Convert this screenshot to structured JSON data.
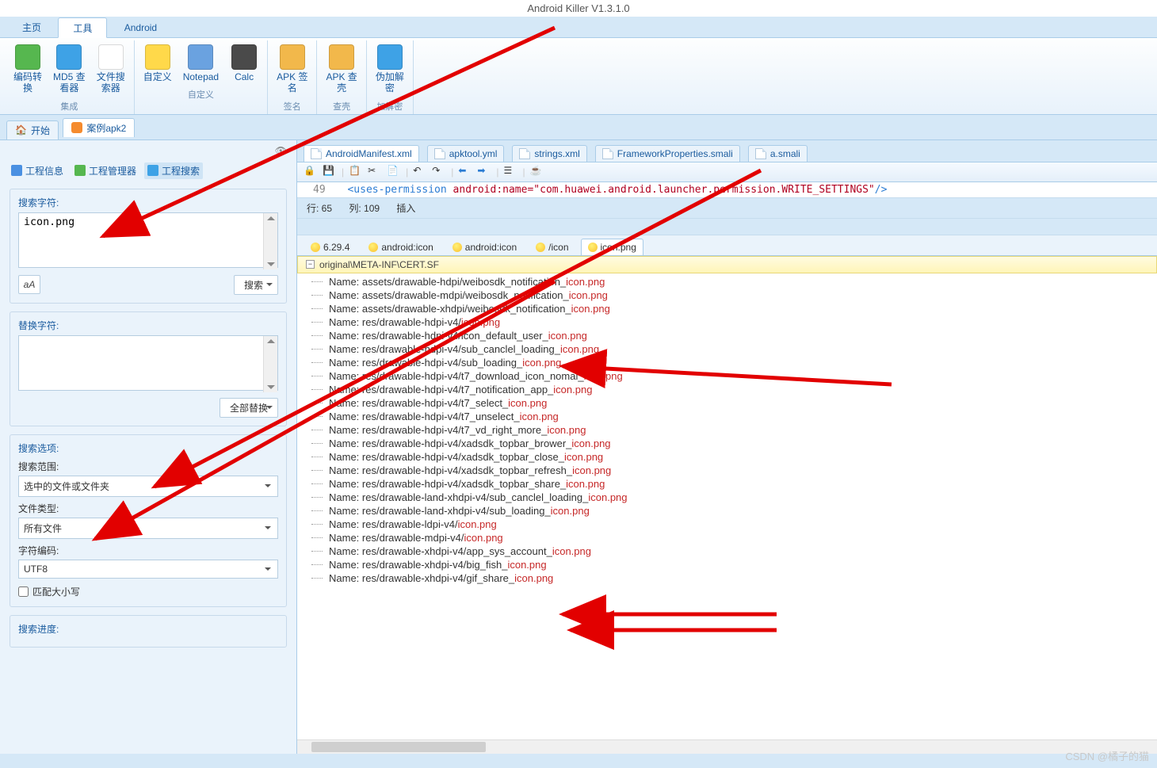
{
  "title": "Android Killer V1.3.1.0",
  "menu": {
    "home": "主页",
    "tools": "工具",
    "android": "Android"
  },
  "ribbon": {
    "group1": {
      "label": "集成",
      "items": [
        {
          "label": "编码转\n换",
          "color": "#56b74f"
        },
        {
          "label": "MD5 查\n看器",
          "color": "#3ea2e6"
        },
        {
          "label": "文件搜\n索器",
          "color": "#ffffff"
        }
      ]
    },
    "group2": {
      "label": "自定义",
      "items": [
        {
          "label": "自定义",
          "color": "#ffd94a"
        },
        {
          "label": "Notepad",
          "color": "#6aa2e0"
        },
        {
          "label": "Calc",
          "color": "#4a4a4a"
        }
      ]
    },
    "group3": {
      "label": "签名",
      "items": [
        {
          "label": "APK 签\n名",
          "color": "#f2b84b"
        }
      ]
    },
    "group4": {
      "label": "查壳",
      "items": [
        {
          "label": "APK 查\n壳",
          "color": "#f2b84b"
        }
      ]
    },
    "group5": {
      "label": "加解密",
      "items": [
        {
          "label": "伪加解\n密",
          "color": "#3ea2e6"
        }
      ]
    }
  },
  "worktabs": {
    "start": "开始",
    "project": "案例apk2"
  },
  "sidebar": {
    "tabs": {
      "info": "工程信息",
      "manager": "工程管理器",
      "search": "工程搜索"
    },
    "search_label": "搜索字符:",
    "search_value": "icon.png",
    "font_btn": "aA",
    "search_btn": "搜索",
    "replace_label": "替换字符:",
    "replace_value": "",
    "replace_all_btn": "全部替换",
    "options_label": "搜索选项:",
    "scope_label": "搜索范围:",
    "scope_value": "选中的文件或文件夹",
    "filetype_label": "文件类型:",
    "filetype_value": "所有文件",
    "encoding_label": "字符编码:",
    "encoding_value": "UTF8",
    "matchcase_label": "匹配大小写",
    "progress_label": "搜索进度:"
  },
  "filetabs": [
    {
      "label": "AndroidManifest.xml",
      "active": true
    },
    {
      "label": "apktool.yml"
    },
    {
      "label": "strings.xml"
    },
    {
      "label": "FrameworkProperties.smali"
    },
    {
      "label": "a.smali"
    }
  ],
  "code": {
    "line_no": "49",
    "prefix": "<uses-permission",
    "attr": " android:name=",
    "val": "\"com.huawei.android.launcher.permission.WRITE_SETTINGS\"",
    "suffix": "/>"
  },
  "status": {
    "line": "行: 65",
    "col": "列: 109",
    "mode": "插入"
  },
  "restabs": [
    {
      "label": "6.29.4"
    },
    {
      "label": "android:icon"
    },
    {
      "label": "android:icon"
    },
    {
      "label": "/icon"
    },
    {
      "label": "icon.png",
      "active": true
    }
  ],
  "resheader": "original\\META-INF\\CERT.SF",
  "results": [
    {
      "p": "Name: assets/drawable-hdpi/weibosdk_notification_",
      "h": "icon.png"
    },
    {
      "p": "Name: assets/drawable-mdpi/weibosdk_notification_",
      "h": "icon.png"
    },
    {
      "p": "Name: assets/drawable-xhdpi/weibosdk_notification_",
      "h": "icon.png"
    },
    {
      "p": "Name: res/drawable-hdpi-v4/",
      "h": "icon.png"
    },
    {
      "p": "Name: res/drawable-hdpi-v4/icon_default_user_",
      "h": "icon.png"
    },
    {
      "p": "Name: res/drawable-hdpi-v4/sub_canclel_loading_",
      "h": "icon.png"
    },
    {
      "p": "Name: res/drawable-hdpi-v4/sub_loading_",
      "h": "icon.png"
    },
    {
      "p": "Name: res/drawable-hdpi-v4/t7_download_icon_nomal_",
      "h": "icon.png"
    },
    {
      "p": "Name: res/drawable-hdpi-v4/t7_notification_app_",
      "h": "icon.png"
    },
    {
      "p": "Name: res/drawable-hdpi-v4/t7_select_",
      "h": "icon.png"
    },
    {
      "p": "Name: res/drawable-hdpi-v4/t7_unselect_",
      "h": "icon.png"
    },
    {
      "p": "Name: res/drawable-hdpi-v4/t7_vd_right_more_",
      "h": "icon.png"
    },
    {
      "p": "Name: res/drawable-hdpi-v4/xadsdk_topbar_brower_",
      "h": "icon.png"
    },
    {
      "p": "Name: res/drawable-hdpi-v4/xadsdk_topbar_close_",
      "h": "icon.png"
    },
    {
      "p": "Name: res/drawable-hdpi-v4/xadsdk_topbar_refresh_",
      "h": "icon.png"
    },
    {
      "p": "Name: res/drawable-hdpi-v4/xadsdk_topbar_share_",
      "h": "icon.png"
    },
    {
      "p": "Name: res/drawable-land-xhdpi-v4/sub_canclel_loading_",
      "h": "icon.png"
    },
    {
      "p": "Name: res/drawable-land-xhdpi-v4/sub_loading_",
      "h": "icon.png"
    },
    {
      "p": "Name: res/drawable-ldpi-v4/",
      "h": "icon.png"
    },
    {
      "p": "Name: res/drawable-mdpi-v4/",
      "h": "icon.png"
    },
    {
      "p": "Name: res/drawable-xhdpi-v4/app_sys_account_",
      "h": "icon.png"
    },
    {
      "p": "Name: res/drawable-xhdpi-v4/big_fish_",
      "h": "icon.png"
    },
    {
      "p": "Name: res/drawable-xhdpi-v4/gif_share_",
      "h": "icon.png"
    }
  ],
  "watermark": "CSDN @橘子的猫"
}
